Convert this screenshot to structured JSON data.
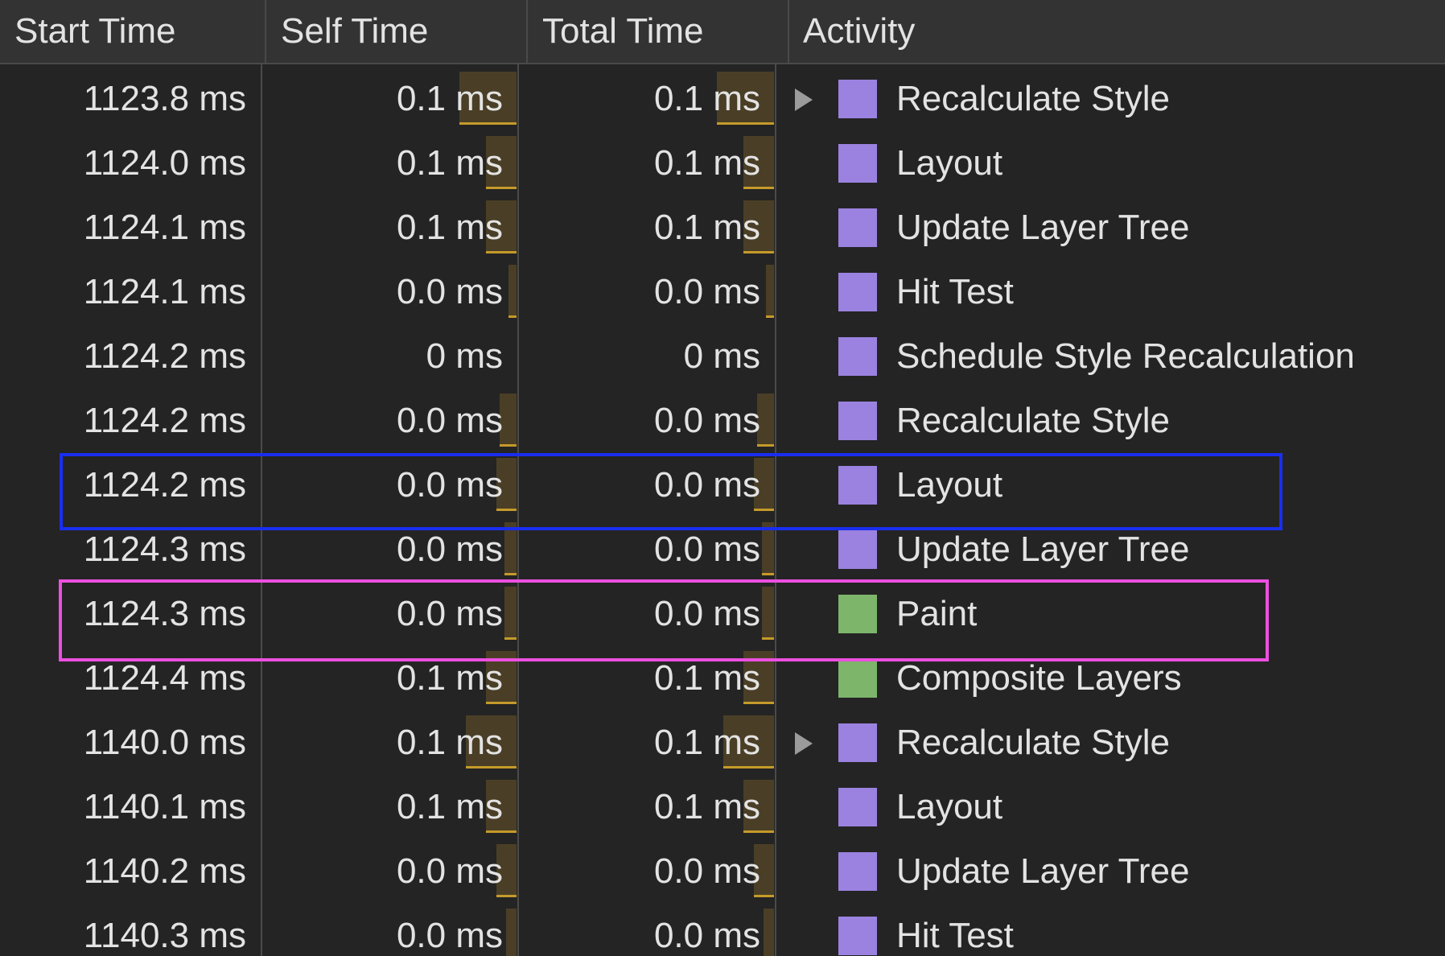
{
  "colors": {
    "background": "#242424",
    "header_background": "#333333",
    "divider": "#4a4a4a",
    "text": "#e3e3e3",
    "time_bar_fill": "#4a3f26",
    "time_bar_edge": "#c59a2a",
    "rendering_purple": "#9b82e0",
    "painting_green": "#7db56b",
    "highlight_blue": "#1a2ef0",
    "highlight_pink": "#ec4fe0"
  },
  "columns": [
    "Start Time",
    "Self Time",
    "Total Time",
    "Activity"
  ],
  "rows": [
    {
      "start": "1123.8 ms",
      "self": "0.1 ms",
      "total": "0.1 ms",
      "activity": "Recalculate Style",
      "category": "rendering",
      "expandable": true,
      "bar": 0.85
    },
    {
      "start": "1124.0 ms",
      "self": "0.1 ms",
      "total": "0.1 ms",
      "activity": "Layout",
      "category": "rendering",
      "expandable": false,
      "bar": 0.45
    },
    {
      "start": "1124.1 ms",
      "self": "0.1 ms",
      "total": "0.1 ms",
      "activity": "Update Layer Tree",
      "category": "rendering",
      "expandable": false,
      "bar": 0.45
    },
    {
      "start": "1124.1 ms",
      "self": "0.0 ms",
      "total": "0.0 ms",
      "activity": "Hit Test",
      "category": "rendering",
      "expandable": false,
      "bar": 0.12
    },
    {
      "start": "1124.2 ms",
      "self": "0 ms",
      "total": "0 ms",
      "activity": "Schedule Style Recalculation",
      "category": "rendering",
      "expandable": false,
      "bar": 0
    },
    {
      "start": "1124.2 ms",
      "self": "0.0 ms",
      "total": "0.0 ms",
      "activity": "Recalculate Style",
      "category": "rendering",
      "expandable": false,
      "bar": 0.25
    },
    {
      "start": "1124.2 ms",
      "self": "0.0 ms",
      "total": "0.0 ms",
      "activity": "Layout",
      "category": "rendering",
      "expandable": false,
      "bar": 0.3,
      "highlight": "blue"
    },
    {
      "start": "1124.3 ms",
      "self": "0.0 ms",
      "total": "0.0 ms",
      "activity": "Update Layer Tree",
      "category": "rendering",
      "expandable": false,
      "bar": 0.18
    },
    {
      "start": "1124.3 ms",
      "self": "0.0 ms",
      "total": "0.0 ms",
      "activity": "Paint",
      "category": "painting",
      "expandable": false,
      "bar": 0.18,
      "highlight": "pink"
    },
    {
      "start": "1124.4 ms",
      "self": "0.1 ms",
      "total": "0.1 ms",
      "activity": "Composite Layers",
      "category": "painting",
      "expandable": false,
      "bar": 0.45
    },
    {
      "start": "1140.0 ms",
      "self": "0.1 ms",
      "total": "0.1 ms",
      "activity": "Recalculate Style",
      "category": "rendering",
      "expandable": true,
      "bar": 0.75
    },
    {
      "start": "1140.1 ms",
      "self": "0.1 ms",
      "total": "0.1 ms",
      "activity": "Layout",
      "category": "rendering",
      "expandable": false,
      "bar": 0.45
    },
    {
      "start": "1140.2 ms",
      "self": "0.0 ms",
      "total": "0.0 ms",
      "activity": "Update Layer Tree",
      "category": "rendering",
      "expandable": false,
      "bar": 0.3
    },
    {
      "start": "1140.3 ms",
      "self": "0.0 ms",
      "total": "0.0 ms",
      "activity": "Hit Test",
      "category": "rendering",
      "expandable": false,
      "bar": 0.15
    }
  ],
  "icons": {
    "expand": "triangle-right-icon",
    "category_swatch": "category-color-swatch"
  }
}
